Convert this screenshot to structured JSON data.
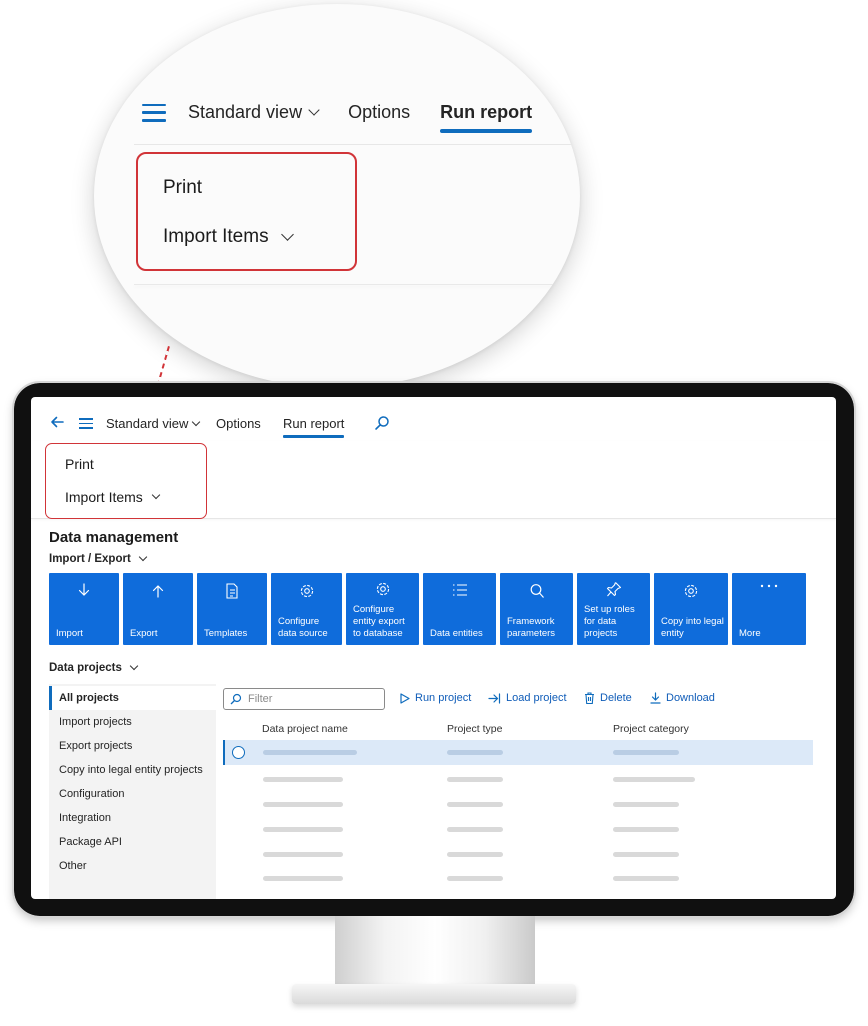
{
  "nav": {
    "standard_view": "Standard view",
    "options": "Options",
    "run_report": "Run report"
  },
  "ribbon": {
    "print": "Print",
    "import_items": "Import Items"
  },
  "page": {
    "title": "Data management",
    "section_import_export": "Import / Export",
    "section_data_projects": "Data projects"
  },
  "tiles": [
    {
      "label": "Import",
      "icon": "download-icon"
    },
    {
      "label": "Export",
      "icon": "upload-icon"
    },
    {
      "label": "Templates",
      "icon": "document-icon"
    },
    {
      "label": "Configure data source",
      "icon": "gear-icon"
    },
    {
      "label": "Configure entity export to database",
      "icon": "gear-icon"
    },
    {
      "label": "Data entities",
      "icon": "list-icon"
    },
    {
      "label": "Framework parameters",
      "icon": "search-icon"
    },
    {
      "label": "Set up roles for data projects",
      "icon": "pin-icon"
    },
    {
      "label": "Copy into legal entity",
      "icon": "gear-icon"
    },
    {
      "label": "More",
      "icon": "more-icon"
    }
  ],
  "project_list": [
    "All projects",
    "Import projects",
    "Export projects",
    "Copy into legal entity projects",
    "Configuration",
    "Integration",
    "Package API",
    "Other"
  ],
  "toolbar": {
    "filter_placeholder": "Filter",
    "run_project": "Run project",
    "load_project": "Load project",
    "delete": "Delete",
    "download": "Download"
  },
  "grid": {
    "columns": [
      "Data project name",
      "Project type",
      "Project category"
    ]
  },
  "colors": {
    "accent": "#0f6cbd",
    "tile_blue": "#0f6cdb",
    "highlight_red": "#d13438"
  }
}
